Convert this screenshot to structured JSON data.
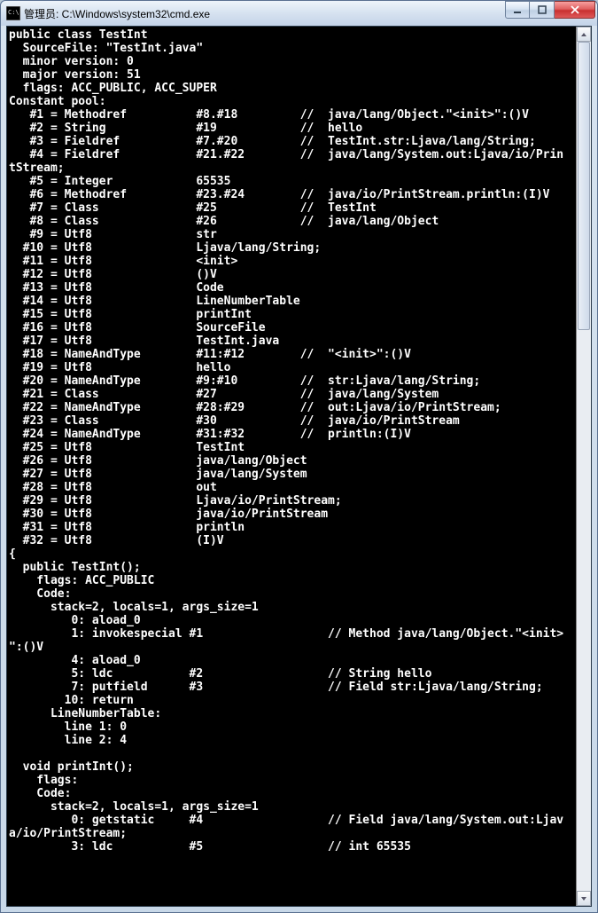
{
  "window": {
    "title": "管理员: C:\\Windows\\system32\\cmd.exe"
  },
  "scrollbar": {
    "thumb_top_pct": 0,
    "thumb_height_pct": 34
  },
  "terminal": {
    "lines": [
      "public class TestInt",
      "  SourceFile: \"TestInt.java\"",
      "  minor version: 0",
      "  major version: 51",
      "  flags: ACC_PUBLIC, ACC_SUPER",
      "Constant pool:",
      "   #1 = Methodref          #8.#18         //  java/lang/Object.\"<init>\":()V",
      "   #2 = String             #19            //  hello",
      "   #3 = Fieldref           #7.#20         //  TestInt.str:Ljava/lang/String;",
      "   #4 = Fieldref           #21.#22        //  java/lang/System.out:Ljava/io/Prin",
      "tStream;",
      "   #5 = Integer            65535",
      "   #6 = Methodref          #23.#24        //  java/io/PrintStream.println:(I)V",
      "   #7 = Class              #25            //  TestInt",
      "   #8 = Class              #26            //  java/lang/Object",
      "   #9 = Utf8               str",
      "  #10 = Utf8               Ljava/lang/String;",
      "  #11 = Utf8               <init>",
      "  #12 = Utf8               ()V",
      "  #13 = Utf8               Code",
      "  #14 = Utf8               LineNumberTable",
      "  #15 = Utf8               printInt",
      "  #16 = Utf8               SourceFile",
      "  #17 = Utf8               TestInt.java",
      "  #18 = NameAndType        #11:#12        //  \"<init>\":()V",
      "  #19 = Utf8               hello",
      "  #20 = NameAndType        #9:#10         //  str:Ljava/lang/String;",
      "  #21 = Class              #27            //  java/lang/System",
      "  #22 = NameAndType        #28:#29        //  out:Ljava/io/PrintStream;",
      "  #23 = Class              #30            //  java/io/PrintStream",
      "  #24 = NameAndType        #31:#32        //  println:(I)V",
      "  #25 = Utf8               TestInt",
      "  #26 = Utf8               java/lang/Object",
      "  #27 = Utf8               java/lang/System",
      "  #28 = Utf8               out",
      "  #29 = Utf8               Ljava/io/PrintStream;",
      "  #30 = Utf8               java/io/PrintStream",
      "  #31 = Utf8               println",
      "  #32 = Utf8               (I)V",
      "{",
      "  public TestInt();",
      "    flags: ACC_PUBLIC",
      "    Code:",
      "      stack=2, locals=1, args_size=1",
      "         0: aload_0",
      "         1: invokespecial #1                  // Method java/lang/Object.\"<init>",
      "\":()V",
      "         4: aload_0",
      "         5: ldc           #2                  // String hello",
      "         7: putfield      #3                  // Field str:Ljava/lang/String;",
      "        10: return",
      "      LineNumberTable:",
      "        line 1: 0",
      "        line 2: 4",
      "",
      "  void printInt();",
      "    flags:",
      "    Code:",
      "      stack=2, locals=1, args_size=1",
      "         0: getstatic     #4                  // Field java/lang/System.out:Ljav",
      "a/io/PrintStream;",
      "         3: ldc           #5                  // int 65535"
    ]
  }
}
